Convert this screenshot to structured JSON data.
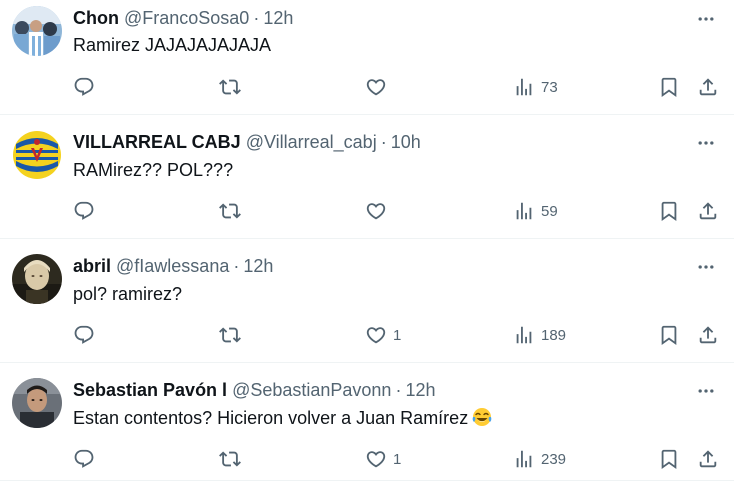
{
  "colors": {
    "text": "#0f1419",
    "muted": "#536471",
    "divider": "#eff3f4"
  },
  "tweets": [
    {
      "name": "Chon",
      "handle": "@FrancoSosa0",
      "sep": "·",
      "time": "12h",
      "text": "Ramirez JAJAJAJAJAJA",
      "likes": "",
      "views": "73"
    },
    {
      "name": "VILLARREAL CABJ",
      "handle": "@Villarreal_cabj",
      "sep": "·",
      "time": "10h",
      "text": "RAMirez?? POL???",
      "likes": "",
      "views": "59"
    },
    {
      "name": "abril",
      "handle": "@fIawlessana",
      "sep": "·",
      "time": "12h",
      "text": "pol? ramirez?",
      "likes": "1",
      "views": "189"
    },
    {
      "name": "Sebastian Pavón l",
      "handle": "@SebastianPavonn",
      "sep": "·",
      "time": "12h",
      "text": "Estan contentos? Hicieron volver a Juan Ramírez",
      "emoji": "face-with-tears-of-joy",
      "likes": "1",
      "views": "239"
    }
  ]
}
